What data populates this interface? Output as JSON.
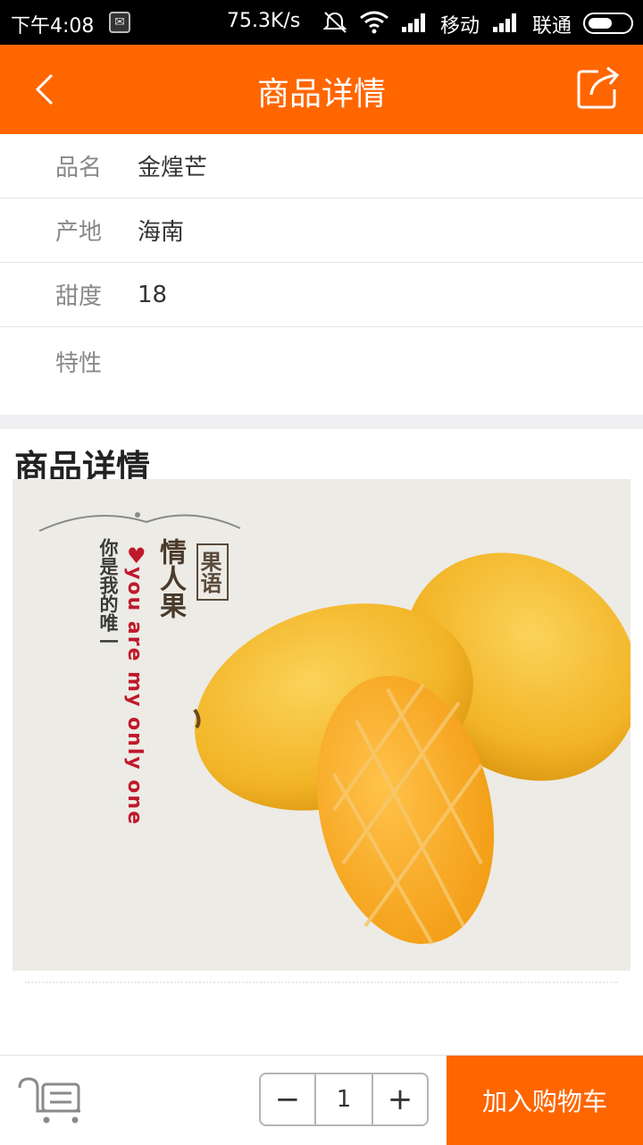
{
  "status_bar": {
    "time": "下午4:08",
    "net_speed": "75.3K/s",
    "carrier1": "移动",
    "carrier2": "联通"
  },
  "nav": {
    "title": "商品详情",
    "back_icon": "chevron-left-icon",
    "share_icon": "share-icon"
  },
  "info": [
    {
      "label": "品名",
      "value": "金煌芒"
    },
    {
      "label": "产地",
      "value": "海南"
    },
    {
      "label": "甜度",
      "value": "18"
    },
    {
      "label": "特性",
      "value": ""
    }
  ],
  "detail": {
    "title": "商品详情"
  },
  "poster": {
    "stamp": "果语",
    "headline": "情人果",
    "vertical_cn": "你是我的唯一",
    "vertical_en": "you are my only one",
    "colors": {
      "background": "#ecebe6",
      "accent_red": "#c0182b",
      "mango": "#f2b426"
    }
  },
  "bottom_bar": {
    "cart_icon": "cart-list-icon",
    "minus": "−",
    "quantity": "1",
    "plus": "+",
    "add_to_cart": "加入购物车"
  },
  "colors": {
    "brand": "#ff6600",
    "nav_text": "#ffffff"
  }
}
